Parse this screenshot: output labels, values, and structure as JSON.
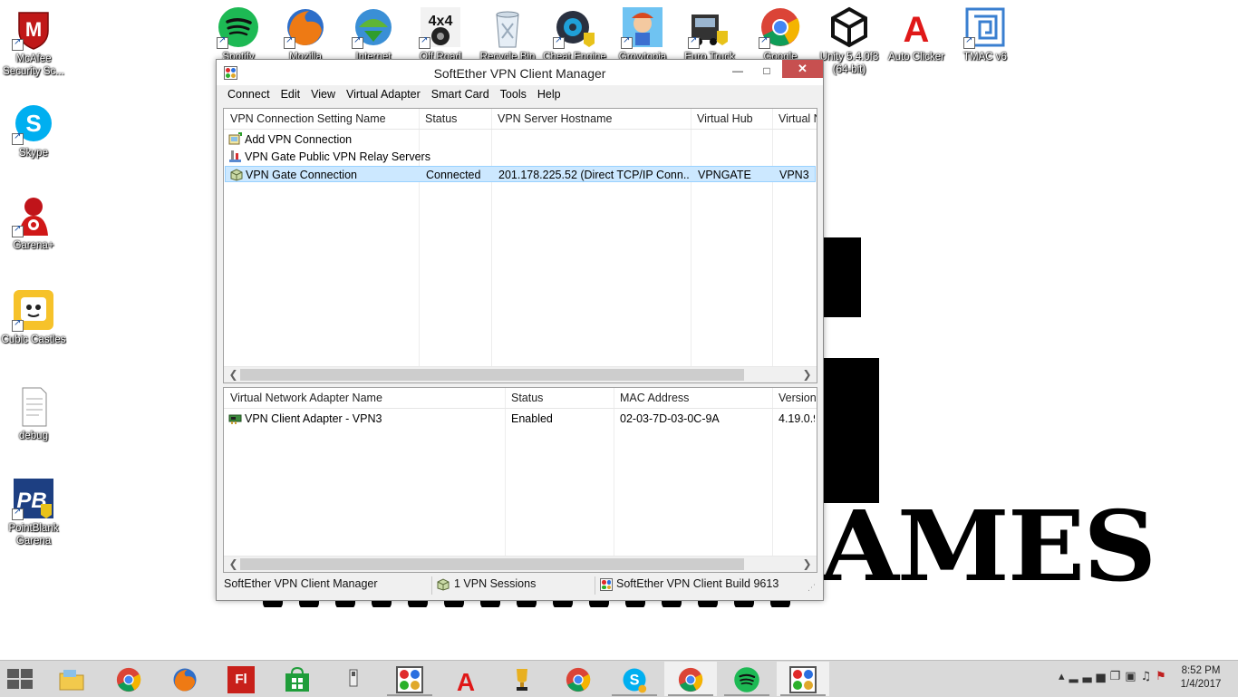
{
  "desktop": {
    "left_icons": [
      {
        "label": "McAfee\nSecurity Sc...",
        "icon": "mcafee-shield-icon"
      },
      {
        "label": "Skype",
        "icon": "skype-icon"
      },
      {
        "label": "Garena+",
        "icon": "garena-icon"
      },
      {
        "label": "Cubic Castles",
        "icon": "cubic-castles-icon"
      },
      {
        "label": "debug",
        "icon": "text-file-icon"
      },
      {
        "label": "PointBlank\nGarena",
        "icon": "pointblank-icon"
      }
    ],
    "top_icons": [
      {
        "label": "Spotify",
        "icon": "spotify-icon"
      },
      {
        "label": "Mozilla",
        "icon": "firefox-icon"
      },
      {
        "label": "Internet",
        "icon": "internet-download-manager-icon"
      },
      {
        "label": "Off Road",
        "icon": "off-road-4x4-icon"
      },
      {
        "label": "Recycle Bin",
        "icon": "recycle-bin-icon"
      },
      {
        "label": "Cheat Engine",
        "icon": "cheat-engine-icon"
      },
      {
        "label": "Growtopia",
        "icon": "growtopia-icon"
      },
      {
        "label": "Euro Truck",
        "icon": "euro-truck-icon"
      },
      {
        "label": "Google",
        "icon": "chrome-icon"
      },
      {
        "label": "Unity 5.4.0f3\n(64-bit)",
        "icon": "unity-icon"
      },
      {
        "label": "Auto Clicker",
        "icon": "auto-clicker-icon"
      },
      {
        "label": "TMAC v6",
        "icon": "tmac-icon"
      }
    ],
    "background_text": "AMES"
  },
  "window": {
    "title": "SoftEther VPN Client Manager",
    "controls": {
      "minimize": "—",
      "maximize": "□",
      "close": "✕"
    },
    "menu": [
      "Connect",
      "Edit",
      "View",
      "Virtual Adapter",
      "Smart Card",
      "Tools",
      "Help"
    ],
    "connections": {
      "columns": [
        "VPN Connection Setting Name",
        "Status",
        "VPN Server Hostname",
        "Virtual Hub",
        "Virtual N"
      ],
      "rows": [
        {
          "name": "Add VPN Connection",
          "status": "",
          "host": "",
          "hub": "",
          "nic": ""
        },
        {
          "name": "VPN Gate Public VPN Relay Servers",
          "status": "",
          "host": "",
          "hub": "",
          "nic": ""
        },
        {
          "name": "VPN Gate Connection",
          "status": "Connected",
          "host": "201.178.225.52 (Direct TCP/IP Conn...",
          "hub": "VPNGATE",
          "nic": "VPN3"
        }
      ],
      "selected_row": 2
    },
    "adapters": {
      "columns": [
        "Virtual Network Adapter Name",
        "Status",
        "MAC Address",
        "Version"
      ],
      "rows": [
        {
          "name": "VPN Client Adapter - VPN3",
          "status": "Enabled",
          "mac": "02-03-7D-03-0C-9A",
          "version": "4.19.0.9"
        }
      ]
    },
    "scroll_arrows": {
      "left": "❮",
      "right": "❯"
    },
    "statusbar": {
      "app": "SoftEther VPN Client Manager",
      "sessions": "1 VPN Sessions",
      "build": "SoftEther VPN Client Build 9613"
    }
  },
  "taskbar": {
    "apps": [
      {
        "name": "file-explorer",
        "icon": "folder-icon"
      },
      {
        "name": "chrome",
        "icon": "chrome-icon"
      },
      {
        "name": "firefox",
        "icon": "firefox-icon"
      },
      {
        "name": "flash",
        "icon": "flash-icon",
        "text": "Fl"
      },
      {
        "name": "store",
        "icon": "store-icon"
      },
      {
        "name": "usb-device",
        "icon": "usb-icon"
      },
      {
        "name": "softether",
        "icon": "softether-icon"
      },
      {
        "name": "auto-clicker",
        "icon": "auto-clicker-icon"
      },
      {
        "name": "trophy",
        "icon": "trophy-icon"
      },
      {
        "name": "chrome-2",
        "icon": "chrome-icon"
      },
      {
        "name": "skype",
        "icon": "skype-icon"
      },
      {
        "name": "chrome-3",
        "icon": "chrome-icon"
      },
      {
        "name": "spotify",
        "icon": "spotify-icon"
      },
      {
        "name": "softether-2",
        "icon": "softether-icon"
      }
    ],
    "tray_icons": [
      "▴",
      "▂▃▅",
      "❐",
      "▣",
      "♫",
      "⚑"
    ],
    "clock_time": "8:52 PM",
    "clock_date": "1/4/2017"
  },
  "colors": {
    "selection": "#cce8ff",
    "close_button": "#c75050",
    "taskbar": "#d9d9d9"
  }
}
